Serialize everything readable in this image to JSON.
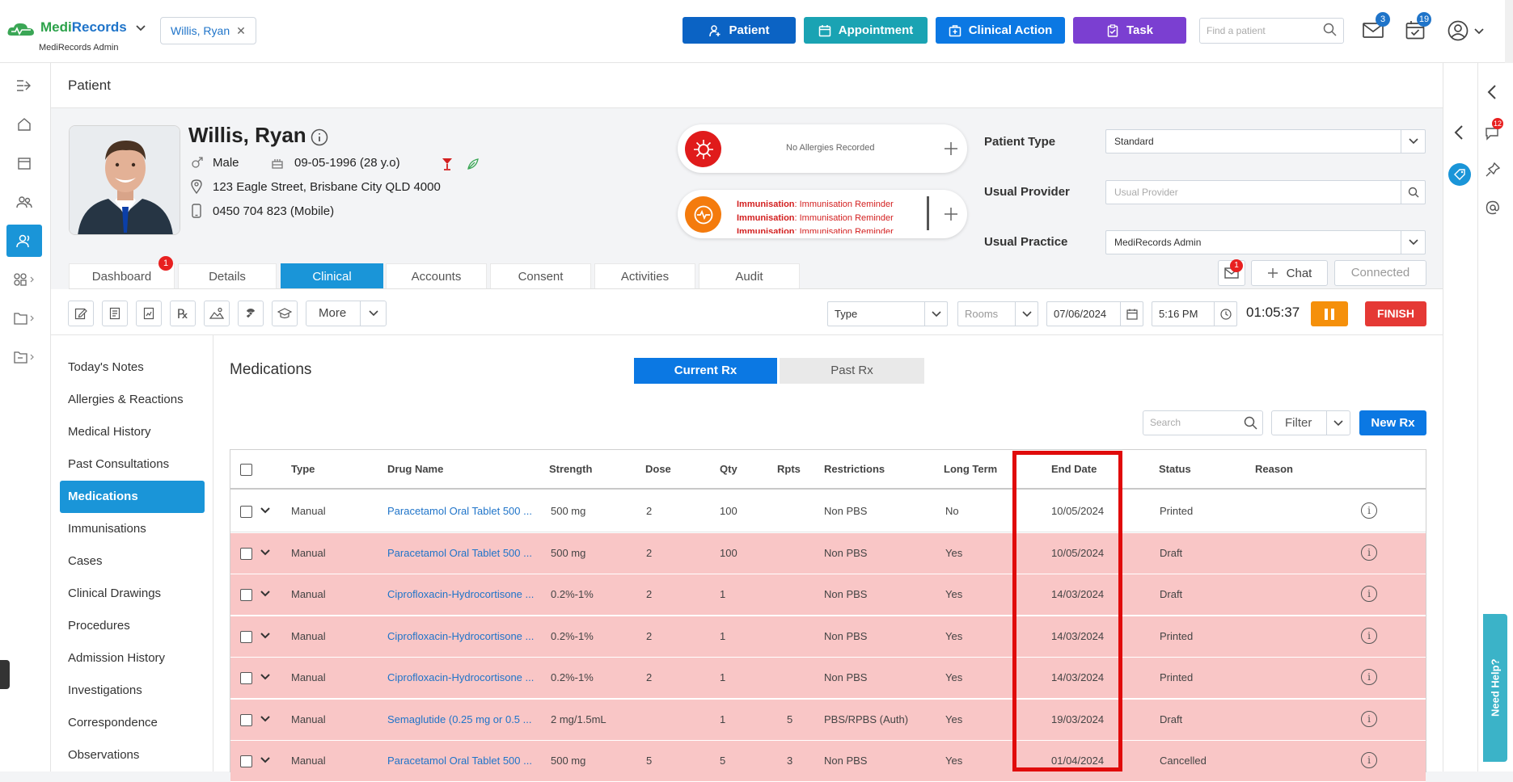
{
  "header": {
    "brand_part1": "Medi",
    "brand_part2": "Records",
    "brand_sub": "MediRecords Admin",
    "patient_chip": "Willis, Ryan",
    "buttons": {
      "patient": "Patient",
      "appointment": "Appointment",
      "clinical_action": "Clinical Action",
      "task": "Task"
    },
    "find_placeholder": "Find a patient",
    "mail_count": "3",
    "tasks_count": "19"
  },
  "page": {
    "title": "Patient"
  },
  "patient": {
    "name": "Willis, Ryan",
    "gender": "Male",
    "dob": "09-05-1996 (28 y.o)",
    "address": "123 Eagle Street, Brisbane City QLD 4000",
    "phone": "0450 704 823 (Mobile)"
  },
  "alerts": {
    "allergies": "No Allergies Recorded",
    "immunisation_label": "Immunisation",
    "immunisation_text": ": Immunisation Reminder"
  },
  "fields": {
    "patient_type_label": "Patient Type",
    "patient_type_value": "Standard",
    "usual_provider_label": "Usual Provider",
    "usual_provider_placeholder": "Usual Provider",
    "usual_practice_label": "Usual Practice",
    "usual_practice_value": "MediRecords Admin"
  },
  "tabs": [
    "Dashboard",
    "Details",
    "Clinical",
    "Accounts",
    "Consent",
    "Activities",
    "Audit"
  ],
  "dashboard_badge": "1",
  "chat": {
    "label": "Chat",
    "badge": "1",
    "connected": "Connected"
  },
  "toolbar": {
    "more": "More",
    "type": "Type",
    "rooms": "Rooms",
    "date": "07/06/2024",
    "time": "5:16 PM",
    "timer": "01:05:37",
    "finish": "FINISH"
  },
  "sidenav": [
    "Today's Notes",
    "Allergies & Reactions",
    "Medical History",
    "Past Consultations",
    "Medications",
    "Immunisations",
    "Cases",
    "Clinical Drawings",
    "Procedures",
    "Admission History",
    "Investigations",
    "Correspondence",
    "Observations"
  ],
  "meds": {
    "title": "Medications",
    "current_rx": "Current Rx",
    "past_rx": "Past Rx",
    "search_placeholder": "Search",
    "filter": "Filter",
    "new_rx": "New Rx",
    "columns": [
      "Type",
      "Drug Name",
      "Strength",
      "Dose",
      "Qty",
      "Rpts",
      "Restrictions",
      "Long Term",
      "End Date",
      "Status",
      "Reason"
    ],
    "rows": [
      {
        "type": "Manual",
        "drug": "Paracetamol Oral Tablet 500 ...",
        "strength": "500 mg",
        "dose": "2",
        "qty": "100",
        "rpts": "",
        "restrictions": "Non PBS",
        "long_term": "No",
        "end_date": "10/05/2024",
        "status": "Printed",
        "reason": "",
        "highlight": false
      },
      {
        "type": "Manual",
        "drug": "Paracetamol Oral Tablet 500 ...",
        "strength": "500 mg",
        "dose": "2",
        "qty": "100",
        "rpts": "",
        "restrictions": "Non PBS",
        "long_term": "Yes",
        "end_date": "10/05/2024",
        "status": "Draft",
        "reason": "",
        "highlight": true
      },
      {
        "type": "Manual",
        "drug": "Ciprofloxacin-Hydrocortisone ...",
        "strength": "0.2%-1%",
        "dose": "2",
        "qty": "1",
        "rpts": "",
        "restrictions": "Non PBS",
        "long_term": "Yes",
        "end_date": "14/03/2024",
        "status": "Draft",
        "reason": "",
        "highlight": true
      },
      {
        "type": "Manual",
        "drug": "Ciprofloxacin-Hydrocortisone ...",
        "strength": "0.2%-1%",
        "dose": "2",
        "qty": "1",
        "rpts": "",
        "restrictions": "Non PBS",
        "long_term": "Yes",
        "end_date": "14/03/2024",
        "status": "Printed",
        "reason": "",
        "highlight": true
      },
      {
        "type": "Manual",
        "drug": "Ciprofloxacin-Hydrocortisone ...",
        "strength": "0.2%-1%",
        "dose": "2",
        "qty": "1",
        "rpts": "",
        "restrictions": "Non PBS",
        "long_term": "Yes",
        "end_date": "14/03/2024",
        "status": "Printed",
        "reason": "",
        "highlight": true
      },
      {
        "type": "Manual",
        "drug": "Semaglutide (0.25 mg or 0.5 ...",
        "strength": "2 mg/1.5mL",
        "dose": "",
        "qty": "1",
        "rpts": "5",
        "restrictions": "PBS/RPBS (Auth)",
        "long_term": "Yes",
        "end_date": "19/03/2024",
        "status": "Draft",
        "reason": "",
        "highlight": true
      },
      {
        "type": "Manual",
        "drug": "Paracetamol Oral Tablet 500 ...",
        "strength": "500 mg",
        "dose": "5",
        "qty": "5",
        "rpts": "3",
        "restrictions": "Non PBS",
        "long_term": "Yes",
        "end_date": "01/04/2024",
        "status": "Cancelled",
        "reason": "",
        "highlight": true
      }
    ]
  },
  "right_rail": {
    "messages_badge": "12",
    "need_help": "Need Help?"
  },
  "colors": {
    "primary": "#0b78e3",
    "teal": "#1aa3b3",
    "purple": "#7b3fd1",
    "highlight_row": "#f9c6c6",
    "accent": "#1a95d8",
    "finish": "#e53935",
    "pause": "#f5900b"
  }
}
